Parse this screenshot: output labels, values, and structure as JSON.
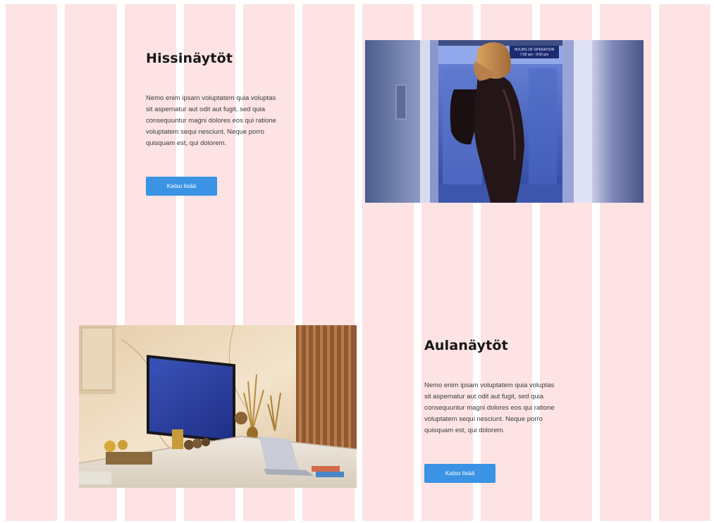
{
  "sections": [
    {
      "title": "Hissinäytöt",
      "body_lines": [
        "Nemo enim ipsam voluptatem quia voluptas",
        "sit aspernatur aut odit aut fugit, sed quia",
        "consequuntur magni dolores eos qui ratione",
        "voluptatem sequi nesciunt. Neque porro",
        "quisquam est, qui dolorem."
      ],
      "button_label": "Katso lisää"
    },
    {
      "title": "Aulanäytöt",
      "body_lines": [
        "Nemo enim ipsam voluptatem quia voluptas",
        "sit aspernatur aut odit aut fugit, sed quia",
        "consequuntur magni dolores eos qui ratione",
        "voluptatem sequi nesciunt. Neque porro",
        "quisquam est, qui dolorem."
      ],
      "button_label": "Katso lisää"
    }
  ],
  "elevator_sign": {
    "line1": "HOURS OF OPERATION",
    "line2": "7:00 am - 9:00 pm"
  },
  "colors": {
    "grid_column": "#fde3e3",
    "button": "#3a93e4",
    "heading": "#171717",
    "body_text": "#3b3b3b"
  }
}
